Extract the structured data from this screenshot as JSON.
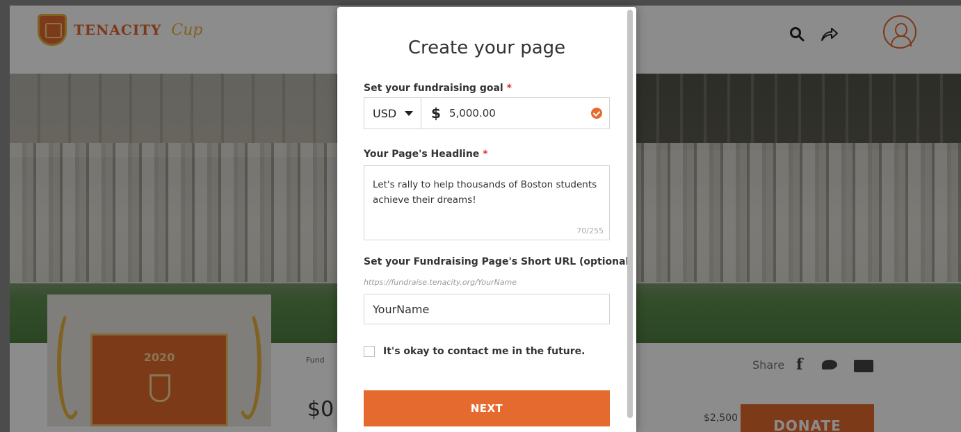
{
  "brand": {
    "name_word": "TENACITY",
    "name_script": "Cup",
    "accent_color": "#e46a2f",
    "gold_color": "#e9b23d"
  },
  "header": {
    "icons": [
      "search-icon",
      "share-icon",
      "user-avatar-icon"
    ]
  },
  "fundraiser": {
    "badge_year": "2020",
    "fund_label": "Fund",
    "raised_amount": "$0",
    "share_label": "Share",
    "social_icons": [
      "facebook-icon",
      "twitter-icon",
      "mail-icon"
    ],
    "goal_amount": "$2,500",
    "donate_label": "DONATE"
  },
  "modal": {
    "title": "Create your page",
    "goal": {
      "label": "Set your fundraising goal",
      "required_mark": "*",
      "currency": "USD",
      "currency_symbol": "$",
      "value": "5,000.00"
    },
    "headline": {
      "label": "Your Page's Headline",
      "required_mark": "*",
      "value": "Let's rally to help thousands of Boston students achieve their dreams!",
      "char_count": "70/255"
    },
    "short_url": {
      "label": "Set your Fundraising Page's Short URL (optional)",
      "hint": "https://fundraise.tenacity.org/YourName",
      "value": "YourName"
    },
    "contact": {
      "label": "It's okay to contact me in the future.",
      "checked": false
    },
    "next_label": "NEXT"
  }
}
